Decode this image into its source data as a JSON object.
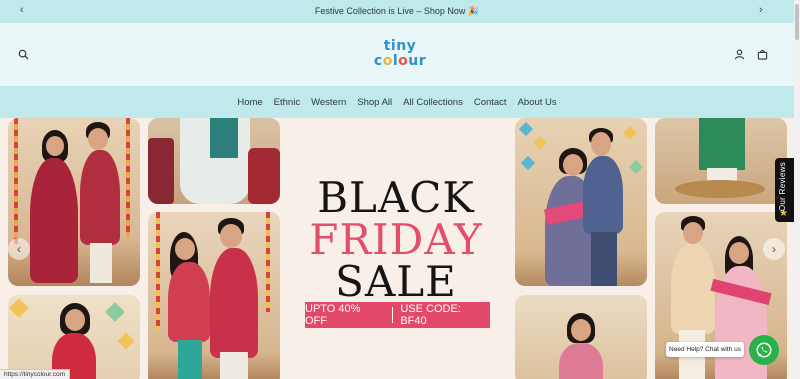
{
  "announcement": {
    "text": "Festive Collection is Live – Shop Now 🎉",
    "prev_icon": "chevron-left-icon",
    "next_icon": "chevron-right-icon"
  },
  "header": {
    "logo_line1": "tiny",
    "logo_line2_a": "c",
    "logo_line2_b": "o",
    "logo_line2_c": "l",
    "logo_line2_d": "o",
    "logo_line2_e": "ur",
    "search_icon": "search-icon",
    "account_icon": "user-icon",
    "bag_icon": "shopping-bag-icon"
  },
  "nav": {
    "items": [
      "Home",
      "Ethnic",
      "Western",
      "Shop All",
      "All Collections",
      "Contact",
      "About Us"
    ]
  },
  "hero": {
    "headline_1": "BLACK",
    "headline_2": "FRIDAY",
    "headline_3": "SALE",
    "promo_offer": "UPTO 40% OFF",
    "promo_code": "USE CODE: BF40"
  },
  "reviews_tab": {
    "label": "Our Reviews",
    "icon": "star-icon"
  },
  "chat": {
    "label": "Need Help? Chat with us",
    "icon": "whatsapp-icon"
  },
  "status_bar": {
    "url": "https://tinycolour.com"
  },
  "colors": {
    "topbar": "#bfe9ea",
    "header_bg": "#eaf7f8",
    "hero_bg": "#f8efe8",
    "accent_pink": "#e2486a",
    "whatsapp_green": "#29b24a"
  }
}
